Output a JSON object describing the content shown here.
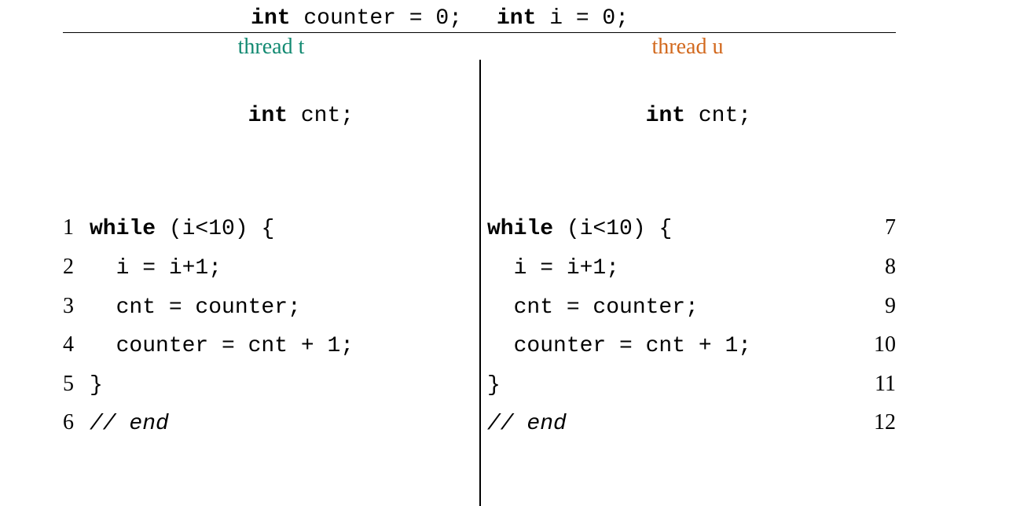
{
  "decl": {
    "left_kw": "int",
    "left_rest": " counter = 0;",
    "right_kw": "int",
    "right_rest": " i = 0;"
  },
  "heading": {
    "t": "thread t",
    "u": "thread u"
  },
  "left": {
    "pre_kw": "int",
    "pre_rest": " cnt;",
    "l1": {
      "num": "1",
      "kw": "while",
      "rest": " (i<10) {"
    },
    "l2": {
      "num": "2",
      "code": "  i = i+1;"
    },
    "l3": {
      "num": "3",
      "code": "  cnt = counter;"
    },
    "l4": {
      "num": "4",
      "code": "  counter = cnt + 1;"
    },
    "l5": {
      "num": "5",
      "code": "}"
    },
    "l6": {
      "num": "6",
      "code": "// end"
    }
  },
  "right": {
    "pre_kw": "int",
    "pre_rest": " cnt;",
    "l1": {
      "num": "7",
      "kw": "while",
      "rest": " (i<10) {"
    },
    "l2": {
      "num": "8",
      "code": "  i = i+1;"
    },
    "l3": {
      "num": "9",
      "code": "  cnt = counter;"
    },
    "l4": {
      "num": "10",
      "code": "  counter = cnt + 1;"
    },
    "l5": {
      "num": "11",
      "code": "}"
    },
    "l6": {
      "num": "12",
      "code": "// end"
    }
  }
}
